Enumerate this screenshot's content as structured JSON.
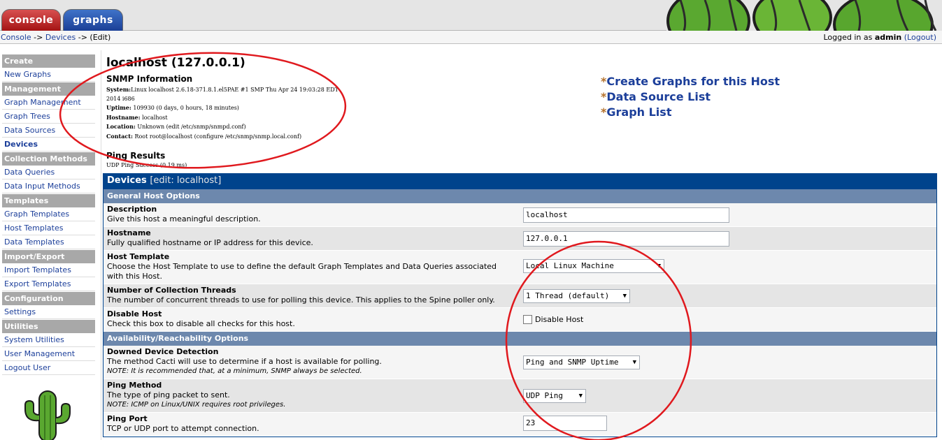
{
  "tabs": [
    {
      "label": "console"
    },
    {
      "label": "graphs"
    }
  ],
  "breadcrumb": {
    "parts": [
      "Console",
      "Devices",
      "(Edit)"
    ],
    "separator": "->"
  },
  "login": {
    "prefix": "Logged in as",
    "user": "admin",
    "logout": "(Logout)"
  },
  "menu": {
    "create_head": "Create",
    "new_graphs": "New Graphs",
    "management_head": "Management",
    "graph_management": "Graph Management",
    "graph_trees": "Graph Trees",
    "data_sources": "Data Sources",
    "devices": "Devices",
    "collection_head": "Collection Methods",
    "data_queries": "Data Queries",
    "data_input_methods": "Data Input Methods",
    "templates_head": "Templates",
    "graph_templates": "Graph Templates",
    "host_templates": "Host Templates",
    "data_templates": "Data Templates",
    "import_export_head": "Import/Export",
    "import_templates": "Import Templates",
    "export_templates": "Export Templates",
    "configuration_head": "Configuration",
    "settings": "Settings",
    "utilities_head": "Utilities",
    "system_utilities": "System Utilities",
    "user_management": "User Management",
    "logout_user": "Logout User"
  },
  "host": {
    "title": "localhost (127.0.0.1)",
    "snmp_heading": "SNMP Information",
    "system_label": "System:",
    "system_value": "Linux localhost 2.6.18-371.8.1.el5PAE #1 SMP Thu Apr 24 19:03:28 EDT",
    "system_value2": "2014 i686",
    "uptime_label": "Uptime:",
    "uptime_value": "109930 (0 days, 0 hours, 18 minutes)",
    "hostname_label": "Hostname:",
    "hostname_value": "localhost",
    "location_label": "Location:",
    "location_value": "Unknown (edit /etc/snmp/snmpd.conf)",
    "contact_label": "Contact:",
    "contact_value": "Root root@localhost (configure /etc/snmp/snmp.local.conf)",
    "ping_heading": "Ping Results",
    "ping_value": "UDP Ping Success (0.19 ms)"
  },
  "links": {
    "create_graphs": "Create Graphs for this Host",
    "data_source_list": "Data Source List",
    "graph_list": "Graph List",
    "star": "*"
  },
  "form": {
    "title": "Devices",
    "subtitle": "[edit: localhost]",
    "general_section": "General Host Options",
    "availability_section": "Availability/Reachability Options",
    "description": {
      "label": "Description",
      "help": "Give this host a meaningful description.",
      "value": "localhost"
    },
    "hostname": {
      "label": "Hostname",
      "help": "Fully qualified hostname or IP address for this device.",
      "value": "127.0.0.1"
    },
    "host_template": {
      "label": "Host Template",
      "help": "Choose the Host Template to use to define the default Graph Templates and Data Queries associated with this Host.",
      "value": "Local Linux Machine"
    },
    "threads": {
      "label": "Number of Collection Threads",
      "help": "The number of concurrent threads to use for polling this device. This applies to the Spine poller only.",
      "value": "1 Thread (default)"
    },
    "disable_host": {
      "label": "Disable Host",
      "help": "Check this box to disable all checks for this host.",
      "checkbox_label": "Disable Host",
      "checked": false
    },
    "downed_detection": {
      "label": "Downed Device Detection",
      "help": "The method Cacti will use to determine if a host is available for polling.",
      "note": "NOTE: It is recommended that, at a minimum, SNMP always be selected.",
      "value": "Ping and SNMP Uptime"
    },
    "ping_method": {
      "label": "Ping Method",
      "help": "The type of ping packet to sent.",
      "note": "NOTE: ICMP on Linux/UNIX requires root privileges.",
      "value": "UDP Ping"
    },
    "ping_port": {
      "label": "Ping Port",
      "help": "TCP or UDP port to attempt connection.",
      "value": "23"
    }
  },
  "colors": {
    "accent": "#00438c",
    "section": "#6d88ad",
    "link": "#1c3f9a",
    "annotation": "#e0191e"
  }
}
